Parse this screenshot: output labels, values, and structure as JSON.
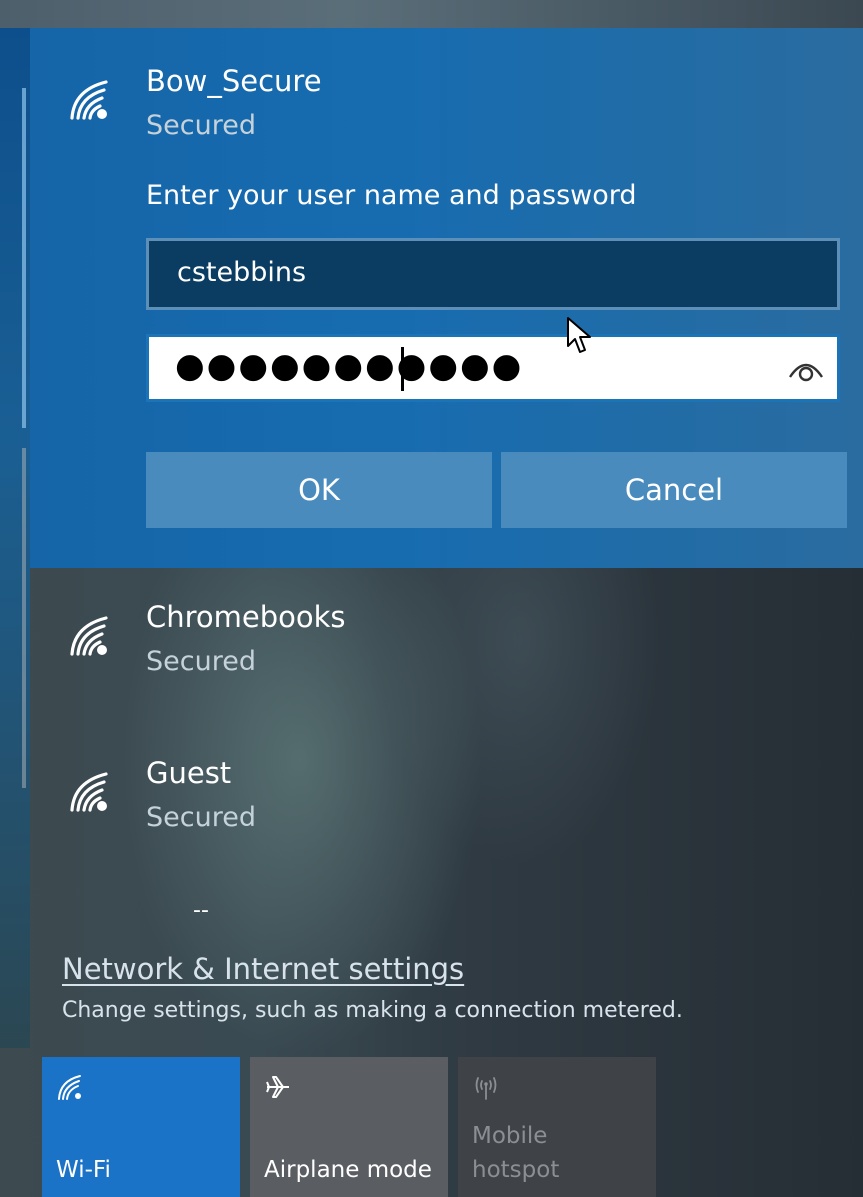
{
  "networks": [
    {
      "name": "Bow_Secure",
      "status": "Secured"
    },
    {
      "name": "Chromebooks",
      "status": "Secured"
    },
    {
      "name": "Guest",
      "status": "Secured"
    }
  ],
  "login_form": {
    "prompt": "Enter your user name and password",
    "username": "cstebbins",
    "password_masked": "●●●●●●●●●●●",
    "ok_label": "OK",
    "cancel_label": "Cancel"
  },
  "dash": "--",
  "settings": {
    "link_label": "Network & Internet settings",
    "description": "Change settings, such as making a connection metered."
  },
  "quick_actions": [
    {
      "label": "Wi-Fi",
      "icon": "wifi-icon",
      "active": true
    },
    {
      "label": "Airplane mode",
      "icon": "airplane-icon",
      "active": false
    },
    {
      "label": "Mobile hotspot",
      "icon": "hotspot-icon",
      "active": false,
      "disabled": true
    }
  ],
  "colors": {
    "accent": "#1a73c7",
    "selected_panel": "#176cb0",
    "button": "#4a8bbd"
  }
}
